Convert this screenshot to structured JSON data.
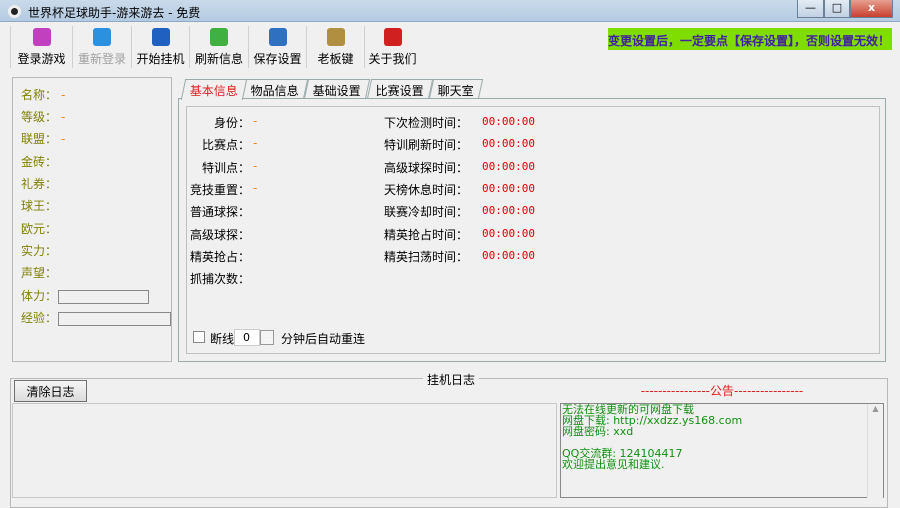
{
  "window": {
    "title": "世界杯足球助手-游来游去 - 免费",
    "minimize": "—",
    "maximize": "□",
    "close": "x"
  },
  "toolbar": [
    {
      "label": "登录游戏",
      "icon": "login-icon",
      "color": "#c040c0",
      "enabled": true
    },
    {
      "label": "重新登录",
      "icon": "relogin-arrow-icon",
      "color": "#2a90e0",
      "enabled": false
    },
    {
      "label": "开始挂机",
      "icon": "computer-icon",
      "color": "#2060c0",
      "enabled": true
    },
    {
      "label": "刷新信息",
      "icon": "refresh-icon",
      "color": "#40b040",
      "enabled": true
    },
    {
      "label": "保存设置",
      "icon": "save-settings-icon",
      "color": "#3070c0",
      "enabled": true
    },
    {
      "label": "老板键",
      "icon": "boss-key-icon",
      "color": "#b09040",
      "enabled": true
    },
    {
      "label": "关于我们",
      "icon": "help-icon",
      "color": "#d02020",
      "enabled": true
    }
  ],
  "notice": "变更设置后，一定要点【保存设置】，否则设置无效！",
  "player": {
    "name_label": "名称：",
    "name": "-",
    "level_label": "等级：",
    "level": "-",
    "league_label": "联盟：",
    "league": "-",
    "gold_label": "金砖：",
    "coupon_label": "礼券：",
    "king_label": "球王：",
    "euro_label": "欧元：",
    "strength_label": "实力：",
    "fame_label": "声望：",
    "stamina_label": "体力：",
    "exp_label": "经验："
  },
  "tabs": [
    "基本信息",
    "物品信息",
    "基础设置",
    "比赛设置",
    "聊天室"
  ],
  "basic": {
    "left": [
      {
        "label": "身份：",
        "value": "-"
      },
      {
        "label": "比赛点：",
        "value": "-"
      },
      {
        "label": "特训点：",
        "value": "-"
      },
      {
        "label": "竞技重置：",
        "value": "-"
      },
      {
        "label": "普通球探：",
        "value": ""
      },
      {
        "label": "高级球探：",
        "value": ""
      },
      {
        "label": "精英抢占：",
        "value": ""
      },
      {
        "label": "抓捕次数：",
        "value": ""
      }
    ],
    "right": [
      {
        "label": "下次检测时间：",
        "value": "00:00:00"
      },
      {
        "label": "特训刷新时间：",
        "value": "00:00:00"
      },
      {
        "label": "高级球探时间：",
        "value": "00:00:00"
      },
      {
        "label": "天榜休息时间：",
        "value": "00:00:00"
      },
      {
        "label": "联赛冷却时间：",
        "value": "00:00:00"
      },
      {
        "label": "精英抢占时间：",
        "value": "00:00:00"
      },
      {
        "label": "精英扫荡时间：",
        "value": "00:00:00"
      }
    ],
    "reconnect_label": "断线",
    "reconnect_minutes": "0",
    "reconnect_suffix": "分钟后自动重连"
  },
  "log": {
    "title": "挂机日志",
    "clear": "清除日志"
  },
  "announcement": {
    "header": "----------------公告----------------",
    "text": "无法在线更新的可网盘下载\n网盘下载: http://xxdzz.ys168.com\n网盘密码: xxd\n\nQQ交流群: 124104417\n欢迎提出意见和建议."
  }
}
